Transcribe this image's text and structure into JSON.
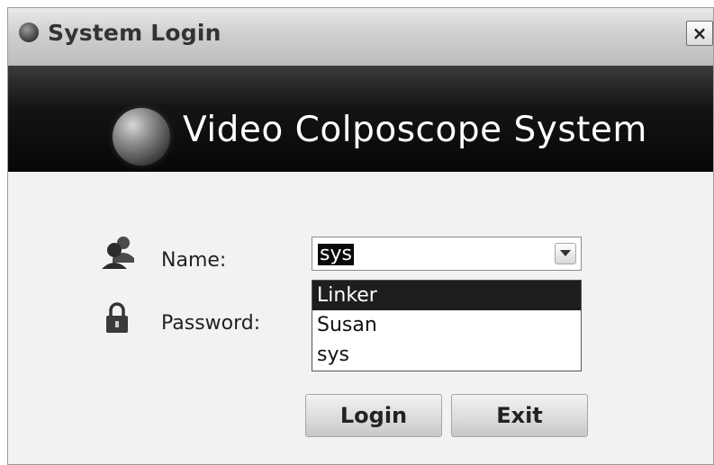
{
  "window": {
    "title": "System Login",
    "close_label": "×"
  },
  "banner": {
    "title": "Video Colposcope System"
  },
  "form": {
    "name_label": "Name:",
    "password_label": "Password:",
    "name_value": "sys",
    "name_options": [
      "Linker",
      "Susan",
      "sys"
    ],
    "highlighted_option": "Linker"
  },
  "buttons": {
    "login_label": "Login",
    "exit_label": "Exit"
  },
  "icons": {
    "title": "app-logo-icon",
    "banner": "app-logo-icon",
    "name": "users-icon",
    "password": "lock-icon",
    "dropdown": "chevron-down-icon"
  },
  "colors": {
    "banner_bg": "#0a0a0a",
    "selection_bg": "#1e1e1e",
    "selection_text": "#ffffff"
  }
}
